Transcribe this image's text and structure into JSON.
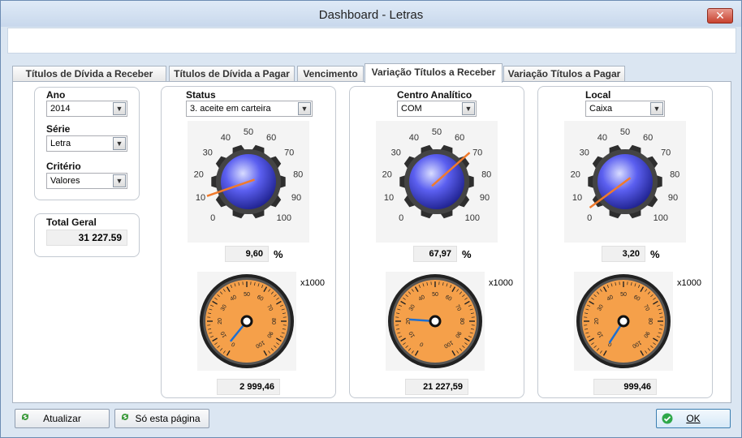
{
  "window": {
    "title": "Dashboard - Letras",
    "close_label": "✕"
  },
  "tabs": [
    {
      "label": "Títulos de Dívida a Receber",
      "active": false
    },
    {
      "label": "Títulos de Dívida a Pagar",
      "active": false
    },
    {
      "label": "Vencimento",
      "active": false
    },
    {
      "label": "Variação Títulos a Receber",
      "active": true
    },
    {
      "label": "Variação Títulos a Pagar",
      "active": false
    }
  ],
  "filters": {
    "ano_label": "Ano",
    "ano_value": "2014",
    "serie_label": "Série",
    "serie_value": "Letra",
    "criterio_label": "Critério",
    "criterio_value": "Valores"
  },
  "total": {
    "label": "Total Geral",
    "value": "31 227.59"
  },
  "panels": [
    {
      "label": "Status",
      "combo": "3. aceite em carteira",
      "percent_value": 9.6,
      "percent_text": "9,60",
      "percent_unit": "%",
      "amount_value": 2.99946,
      "amount_text": "2 999,46",
      "multiplier": "x1000"
    },
    {
      "label": "Centro Analítico",
      "combo": "COM",
      "percent_value": 67.97,
      "percent_text": "67,97",
      "percent_unit": "%",
      "amount_value": 21.22759,
      "amount_text": "21 227,59",
      "multiplier": "x1000"
    },
    {
      "label": "Local",
      "combo": "Caixa",
      "percent_value": 3.2,
      "percent_text": "3,20",
      "percent_unit": "%",
      "amount_value": 0.99946,
      "amount_text": "999,46",
      "multiplier": "x1000"
    }
  ],
  "gauge_scale": {
    "percent_ticks": [
      "0",
      "10",
      "20",
      "30",
      "40",
      "50",
      "60",
      "70",
      "80",
      "90",
      "100"
    ],
    "amount_ticks": [
      "0",
      "10",
      "20",
      "30",
      "40",
      "50",
      "60",
      "70",
      "80",
      "90",
      "100"
    ]
  },
  "buttons": {
    "refresh": "Atualizar",
    "this_page": "Só esta página",
    "ok": "OK"
  },
  "colors": {
    "needle_percent": "#f07a2c",
    "needle_amount": "#1e6fd0",
    "knob": "#5b5ff0",
    "dial_orange": "#f5a04a"
  }
}
